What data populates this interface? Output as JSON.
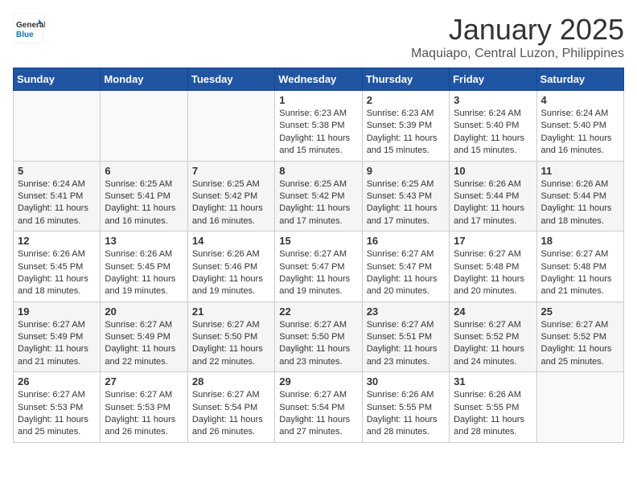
{
  "header": {
    "logo_general": "General",
    "logo_blue": "Blue",
    "month": "January 2025",
    "location": "Maquiapo, Central Luzon, Philippines"
  },
  "weekdays": [
    "Sunday",
    "Monday",
    "Tuesday",
    "Wednesday",
    "Thursday",
    "Friday",
    "Saturday"
  ],
  "weeks": [
    [
      {
        "day": "",
        "sunrise": "",
        "sunset": "",
        "daylight": ""
      },
      {
        "day": "",
        "sunrise": "",
        "sunset": "",
        "daylight": ""
      },
      {
        "day": "",
        "sunrise": "",
        "sunset": "",
        "daylight": ""
      },
      {
        "day": "1",
        "sunrise": "Sunrise: 6:23 AM",
        "sunset": "Sunset: 5:38 PM",
        "daylight": "Daylight: 11 hours and 15 minutes."
      },
      {
        "day": "2",
        "sunrise": "Sunrise: 6:23 AM",
        "sunset": "Sunset: 5:39 PM",
        "daylight": "Daylight: 11 hours and 15 minutes."
      },
      {
        "day": "3",
        "sunrise": "Sunrise: 6:24 AM",
        "sunset": "Sunset: 5:40 PM",
        "daylight": "Daylight: 11 hours and 15 minutes."
      },
      {
        "day": "4",
        "sunrise": "Sunrise: 6:24 AM",
        "sunset": "Sunset: 5:40 PM",
        "daylight": "Daylight: 11 hours and 16 minutes."
      }
    ],
    [
      {
        "day": "5",
        "sunrise": "Sunrise: 6:24 AM",
        "sunset": "Sunset: 5:41 PM",
        "daylight": "Daylight: 11 hours and 16 minutes."
      },
      {
        "day": "6",
        "sunrise": "Sunrise: 6:25 AM",
        "sunset": "Sunset: 5:41 PM",
        "daylight": "Daylight: 11 hours and 16 minutes."
      },
      {
        "day": "7",
        "sunrise": "Sunrise: 6:25 AM",
        "sunset": "Sunset: 5:42 PM",
        "daylight": "Daylight: 11 hours and 16 minutes."
      },
      {
        "day": "8",
        "sunrise": "Sunrise: 6:25 AM",
        "sunset": "Sunset: 5:42 PM",
        "daylight": "Daylight: 11 hours and 17 minutes."
      },
      {
        "day": "9",
        "sunrise": "Sunrise: 6:25 AM",
        "sunset": "Sunset: 5:43 PM",
        "daylight": "Daylight: 11 hours and 17 minutes."
      },
      {
        "day": "10",
        "sunrise": "Sunrise: 6:26 AM",
        "sunset": "Sunset: 5:44 PM",
        "daylight": "Daylight: 11 hours and 17 minutes."
      },
      {
        "day": "11",
        "sunrise": "Sunrise: 6:26 AM",
        "sunset": "Sunset: 5:44 PM",
        "daylight": "Daylight: 11 hours and 18 minutes."
      }
    ],
    [
      {
        "day": "12",
        "sunrise": "Sunrise: 6:26 AM",
        "sunset": "Sunset: 5:45 PM",
        "daylight": "Daylight: 11 hours and 18 minutes."
      },
      {
        "day": "13",
        "sunrise": "Sunrise: 6:26 AM",
        "sunset": "Sunset: 5:45 PM",
        "daylight": "Daylight: 11 hours and 19 minutes."
      },
      {
        "day": "14",
        "sunrise": "Sunrise: 6:26 AM",
        "sunset": "Sunset: 5:46 PM",
        "daylight": "Daylight: 11 hours and 19 minutes."
      },
      {
        "day": "15",
        "sunrise": "Sunrise: 6:27 AM",
        "sunset": "Sunset: 5:47 PM",
        "daylight": "Daylight: 11 hours and 19 minutes."
      },
      {
        "day": "16",
        "sunrise": "Sunrise: 6:27 AM",
        "sunset": "Sunset: 5:47 PM",
        "daylight": "Daylight: 11 hours and 20 minutes."
      },
      {
        "day": "17",
        "sunrise": "Sunrise: 6:27 AM",
        "sunset": "Sunset: 5:48 PM",
        "daylight": "Daylight: 11 hours and 20 minutes."
      },
      {
        "day": "18",
        "sunrise": "Sunrise: 6:27 AM",
        "sunset": "Sunset: 5:48 PM",
        "daylight": "Daylight: 11 hours and 21 minutes."
      }
    ],
    [
      {
        "day": "19",
        "sunrise": "Sunrise: 6:27 AM",
        "sunset": "Sunset: 5:49 PM",
        "daylight": "Daylight: 11 hours and 21 minutes."
      },
      {
        "day": "20",
        "sunrise": "Sunrise: 6:27 AM",
        "sunset": "Sunset: 5:49 PM",
        "daylight": "Daylight: 11 hours and 22 minutes."
      },
      {
        "day": "21",
        "sunrise": "Sunrise: 6:27 AM",
        "sunset": "Sunset: 5:50 PM",
        "daylight": "Daylight: 11 hours and 22 minutes."
      },
      {
        "day": "22",
        "sunrise": "Sunrise: 6:27 AM",
        "sunset": "Sunset: 5:50 PM",
        "daylight": "Daylight: 11 hours and 23 minutes."
      },
      {
        "day": "23",
        "sunrise": "Sunrise: 6:27 AM",
        "sunset": "Sunset: 5:51 PM",
        "daylight": "Daylight: 11 hours and 23 minutes."
      },
      {
        "day": "24",
        "sunrise": "Sunrise: 6:27 AM",
        "sunset": "Sunset: 5:52 PM",
        "daylight": "Daylight: 11 hours and 24 minutes."
      },
      {
        "day": "25",
        "sunrise": "Sunrise: 6:27 AM",
        "sunset": "Sunset: 5:52 PM",
        "daylight": "Daylight: 11 hours and 25 minutes."
      }
    ],
    [
      {
        "day": "26",
        "sunrise": "Sunrise: 6:27 AM",
        "sunset": "Sunset: 5:53 PM",
        "daylight": "Daylight: 11 hours and 25 minutes."
      },
      {
        "day": "27",
        "sunrise": "Sunrise: 6:27 AM",
        "sunset": "Sunset: 5:53 PM",
        "daylight": "Daylight: 11 hours and 26 minutes."
      },
      {
        "day": "28",
        "sunrise": "Sunrise: 6:27 AM",
        "sunset": "Sunset: 5:54 PM",
        "daylight": "Daylight: 11 hours and 26 minutes."
      },
      {
        "day": "29",
        "sunrise": "Sunrise: 6:27 AM",
        "sunset": "Sunset: 5:54 PM",
        "daylight": "Daylight: 11 hours and 27 minutes."
      },
      {
        "day": "30",
        "sunrise": "Sunrise: 6:26 AM",
        "sunset": "Sunset: 5:55 PM",
        "daylight": "Daylight: 11 hours and 28 minutes."
      },
      {
        "day": "31",
        "sunrise": "Sunrise: 6:26 AM",
        "sunset": "Sunset: 5:55 PM",
        "daylight": "Daylight: 11 hours and 28 minutes."
      },
      {
        "day": "",
        "sunrise": "",
        "sunset": "",
        "daylight": ""
      }
    ]
  ]
}
